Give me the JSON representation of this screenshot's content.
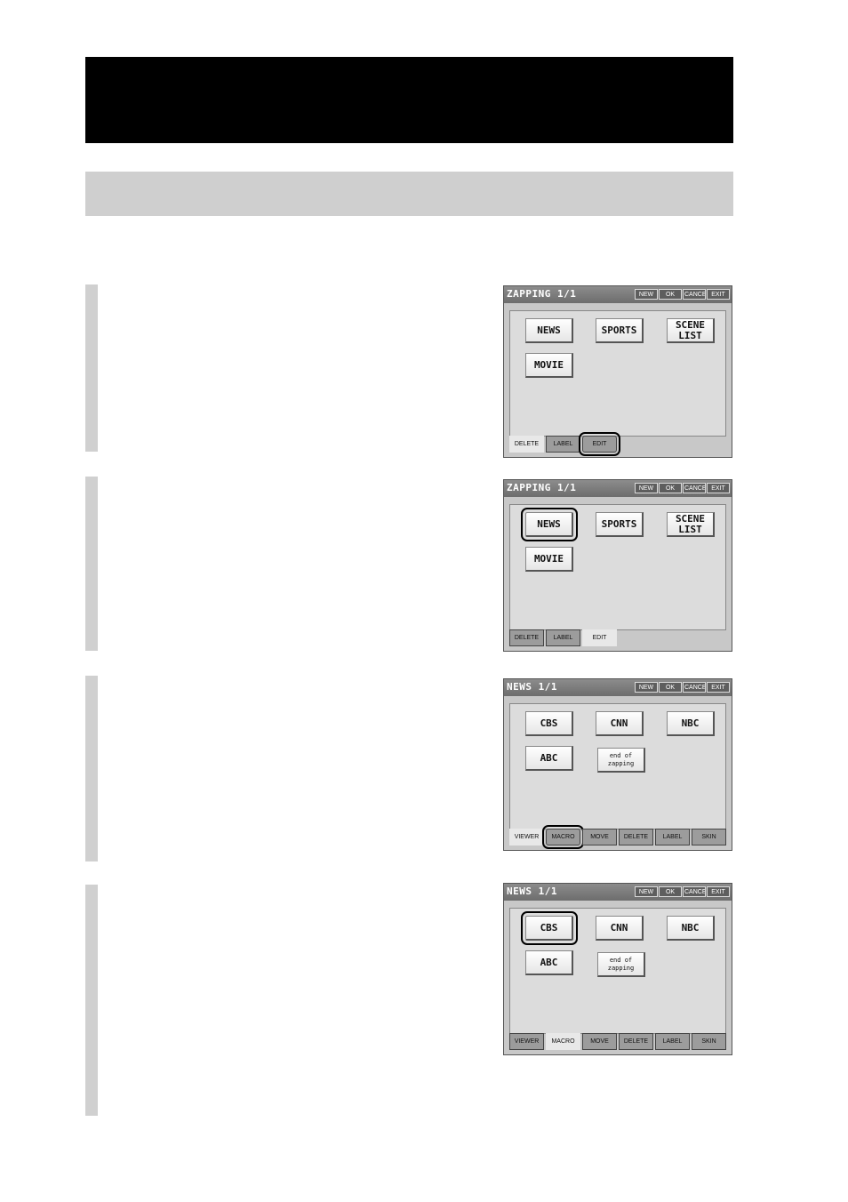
{
  "header_buttons": [
    "NEW",
    "OK",
    "CANCEL",
    "EXIT"
  ],
  "screens": [
    {
      "title": "ZAPPING 1/1",
      "buttons": [
        "NEWS",
        "SPORTS",
        "SCENE LIST",
        "MOVIE"
      ],
      "tabs": [
        "DELETE",
        "LABEL",
        "EDIT"
      ],
      "active_tab": "DELETE",
      "highlighted": "EDIT"
    },
    {
      "title": "ZAPPING 1/1",
      "buttons": [
        "NEWS",
        "SPORTS",
        "SCENE LIST",
        "MOVIE"
      ],
      "tabs": [
        "DELETE",
        "LABEL",
        "EDIT"
      ],
      "active_tab": "EDIT",
      "highlighted": "NEWS"
    },
    {
      "title": "NEWS 1/1",
      "buttons": [
        "CBS",
        "CNN",
        "NBC",
        "ABC",
        "end of zapping"
      ],
      "tabs": [
        "VIEWER",
        "MACRO",
        "MOVE",
        "DELETE",
        "LABEL",
        "SKIN"
      ],
      "active_tab": "VIEWER",
      "highlighted": "MACRO"
    },
    {
      "title": "NEWS 1/1",
      "buttons": [
        "CBS",
        "CNN",
        "NBC",
        "ABC",
        "end of zapping"
      ],
      "tabs": [
        "VIEWER",
        "MACRO",
        "MOVE",
        "DELETE",
        "LABEL",
        "SKIN"
      ],
      "active_tab": "MACRO",
      "highlighted": "CBS"
    }
  ]
}
